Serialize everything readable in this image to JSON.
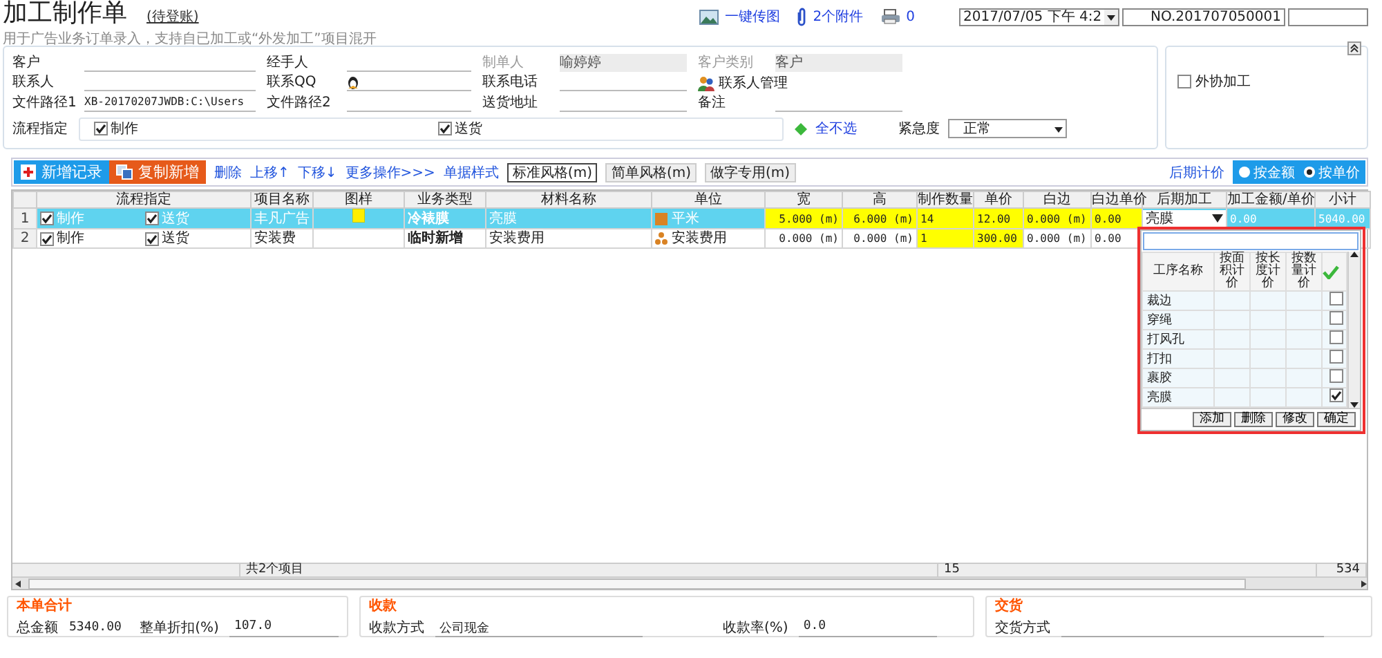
{
  "header": {
    "title": "加工制作单",
    "status": "(待登账)",
    "subtitle": "用于广告业务订单录入，支持自已加工或“外发加工”项目混开",
    "actions": [
      {
        "kind": "image",
        "label": "一键传图"
      },
      {
        "kind": "clip",
        "label": "2个附件"
      },
      {
        "kind": "printer",
        "label": "0"
      }
    ],
    "date": "2017/07/05 下午 4:2",
    "number": "NO.201707050001"
  },
  "form": {
    "fields": [
      {
        "label": "客户",
        "kind": "text"
      },
      {
        "label": "经手人",
        "kind": "text"
      },
      {
        "label": "制单人",
        "kind": "disabled",
        "value": "喻婷婷"
      },
      {
        "label": "客户类别",
        "kind": "disabled",
        "value": "客户"
      },
      {
        "label": "联系人",
        "kind": "text"
      },
      {
        "label": "联系QQ",
        "kind": "qq"
      },
      {
        "label": "联系电话",
        "kind": "text"
      },
      {
        "label": "联系人管理",
        "kind": "link"
      },
      {
        "label": "文件路径1",
        "kind": "text",
        "value": "XB-20170207JWDB:C:\\Users"
      },
      {
        "label": "文件路径2",
        "kind": "text"
      },
      {
        "label": "送货地址",
        "kind": "text"
      },
      {
        "label": "备注",
        "kind": "text"
      }
    ],
    "flow_label": "流程指定",
    "flow": [
      {
        "label": "制作",
        "checked": true
      },
      {
        "label": "送货",
        "checked": true
      }
    ],
    "select_none": "全不选",
    "urgency_label": "紧急度",
    "urgency": "正常",
    "outsource": {
      "label": "外协加工",
      "checked": false
    }
  },
  "toolbar": {
    "buttons": [
      {
        "kind": "add",
        "label": "新增记录"
      },
      {
        "kind": "copy",
        "label": "复制新增"
      }
    ],
    "links": [
      "删除",
      "上移↑",
      "下移↓",
      "更多操作>>>",
      "单据样式"
    ],
    "styles": [
      {
        "label": "标准风格(m)",
        "selected": true
      },
      {
        "label": "简单风格(m)",
        "selected": false
      },
      {
        "label": "做字专用(m)",
        "selected": false
      }
    ],
    "pricing_label": "后期计价",
    "pricing": [
      {
        "label": "按金额",
        "selected": false
      },
      {
        "label": "按单价",
        "selected": true
      }
    ]
  },
  "grid": {
    "columns": [
      "流程指定",
      "项目名称",
      "图样",
      "业务类型",
      "材料名称",
      "单位",
      "宽",
      "高",
      "制作数量",
      "单价",
      "白边",
      "白边单价",
      "后期加工",
      "加工金额/单价",
      "小计"
    ],
    "rows": [
      {
        "index": "1",
        "selected": true,
        "cells": [
          {
            "kind": "flow",
            "items": [
              {
                "label": "制作",
                "checked": true
              },
              {
                "label": "送货",
                "checked": true
              }
            ]
          },
          {
            "kind": "text",
            "text": "丰凡广告"
          },
          {
            "kind": "swatch"
          },
          {
            "kind": "bold",
            "text": "冷裱膜"
          },
          {
            "kind": "text",
            "text": "亮膜"
          },
          {
            "kind": "area",
            "text": "平米"
          },
          {
            "kind": "number",
            "text": "5.000 (m)",
            "editable": true
          },
          {
            "kind": "number",
            "text": "6.000 (m)",
            "editable": true
          },
          {
            "kind": "text",
            "text": "14",
            "editable": true
          },
          {
            "kind": "text",
            "text": "12.00",
            "editable": true
          },
          {
            "kind": "text",
            "text": "0.000 (m)",
            "editable": true
          },
          {
            "kind": "text",
            "text": "0.00",
            "editable": true
          },
          {
            "kind": "select",
            "text": "亮膜"
          },
          {
            "kind": "text",
            "text": "0.00"
          },
          {
            "kind": "text",
            "text": "5040.00"
          }
        ]
      },
      {
        "index": "2",
        "selected": false,
        "cells": [
          {
            "kind": "flow",
            "items": [
              {
                "label": "制作",
                "checked": true
              },
              {
                "label": "送货",
                "checked": true
              }
            ]
          },
          {
            "kind": "text",
            "text": "安装费"
          },
          {
            "kind": "blank"
          },
          {
            "kind": "bold",
            "text": "临时新增"
          },
          {
            "kind": "text",
            "text": "安装费用"
          },
          {
            "kind": "fee",
            "text": "安装费用"
          },
          {
            "kind": "number",
            "text": "0.000 (m)",
            "editable": false
          },
          {
            "kind": "number",
            "text": "0.000 (m)",
            "editable": false
          },
          {
            "kind": "text",
            "text": "1",
            "editable": true
          },
          {
            "kind": "text",
            "text": "300.00",
            "editable": true
          },
          {
            "kind": "text",
            "text": "0.000 (m)",
            "editable": false
          },
          {
            "kind": "text",
            "text": "0.00",
            "editable": false
          }
        ]
      }
    ],
    "footer": [
      {
        "kind": "count",
        "text": "共2个项目"
      },
      {
        "kind": "qty",
        "text": "15"
      },
      {
        "kind": "total",
        "text": "534"
      }
    ]
  },
  "popup": {
    "columns": [
      "工序名称",
      "按面积计价",
      "按长度计价",
      "按数量计价"
    ],
    "rows": [
      {
        "name": "裁边",
        "checked": false
      },
      {
        "name": "穿绳",
        "checked": false
      },
      {
        "name": "打风孔",
        "checked": false
      },
      {
        "name": "打扣",
        "checked": false
      },
      {
        "name": "裹胶",
        "checked": false
      },
      {
        "name": "亮膜",
        "checked": true
      }
    ],
    "buttons": [
      "添加",
      "删除",
      "修改",
      "确定"
    ]
  },
  "summary": [
    {
      "title": "本单合计",
      "fields": [
        {
          "label": "总金额",
          "value": "5340.00",
          "kind": "plain"
        },
        {
          "label": "整单折扣(%)",
          "value": "107.0",
          "kind": "input"
        }
      ]
    },
    {
      "title": "收款",
      "fields": [
        {
          "label": "收款方式",
          "value": "公司现金",
          "kind": "input"
        },
        {
          "label": "收款率(%)",
          "value": "0.0",
          "kind": "input"
        }
      ]
    },
    {
      "title": "交货",
      "fields": [
        {
          "label": "交货方式",
          "kind": "input"
        }
      ]
    }
  ]
}
